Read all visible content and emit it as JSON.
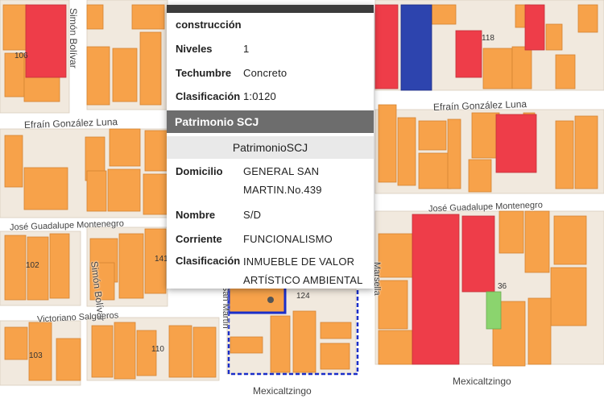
{
  "colors": {
    "built": "#f7a24a",
    "built_edge": "#d48433",
    "high_value": "#ee3d49",
    "special": "#2d44ae",
    "green": "#8bd46e",
    "street": "#ffffff",
    "block_bg": "#f1e9de",
    "selection": "#1a2ec9",
    "popup_header": "#6d6d6d"
  },
  "streets": {
    "simon_bolivar_top": "Simón Bolívar",
    "simon_bolivar_bottom": "Simón Bolívar",
    "efrain_left": "Efraín González Luna",
    "efrain_right": "Efraín González Luna",
    "jose_left": "José Guadalupe Montenegro",
    "jose_right": "José Guadalupe Montenegro",
    "victoriano": "Victoriano Salgueros",
    "san_martin": "San Martín",
    "marsella": "Marsella",
    "mexicaltzingo_bottom": "Mexicaltzingo",
    "mexicaltzingo_right": "Mexicaltzingo"
  },
  "parcel_numbers": {
    "n106": "106",
    "n118": "118",
    "n102": "102",
    "n141": "141",
    "n124": "124",
    "n36": "36",
    "n103": "103",
    "n110": "110"
  },
  "popup": {
    "construccion": "construcción",
    "niveles_label": "Niveles",
    "niveles_value": "1",
    "techumbre_label": "Techumbre",
    "techumbre_value": "Concreto",
    "clasificacion_label": "Clasificación",
    "clasificacion_value": "1:0120",
    "header": "Patrimonio SCJ",
    "subheader": "PatrimonioSCJ",
    "domicilio_label": "Domicilio",
    "domicilio_value": "GENERAL SAN MARTIN.No.439",
    "nombre_label": "Nombre",
    "nombre_value": "S/D",
    "corriente_label": "Corriente",
    "corriente_value": "FUNCIONALISMO",
    "clasificacion2_label": "Clasificación",
    "clasificacion2_value": "INMUEBLE DE VALOR ARTÍSTICO AMBIENTAL"
  }
}
